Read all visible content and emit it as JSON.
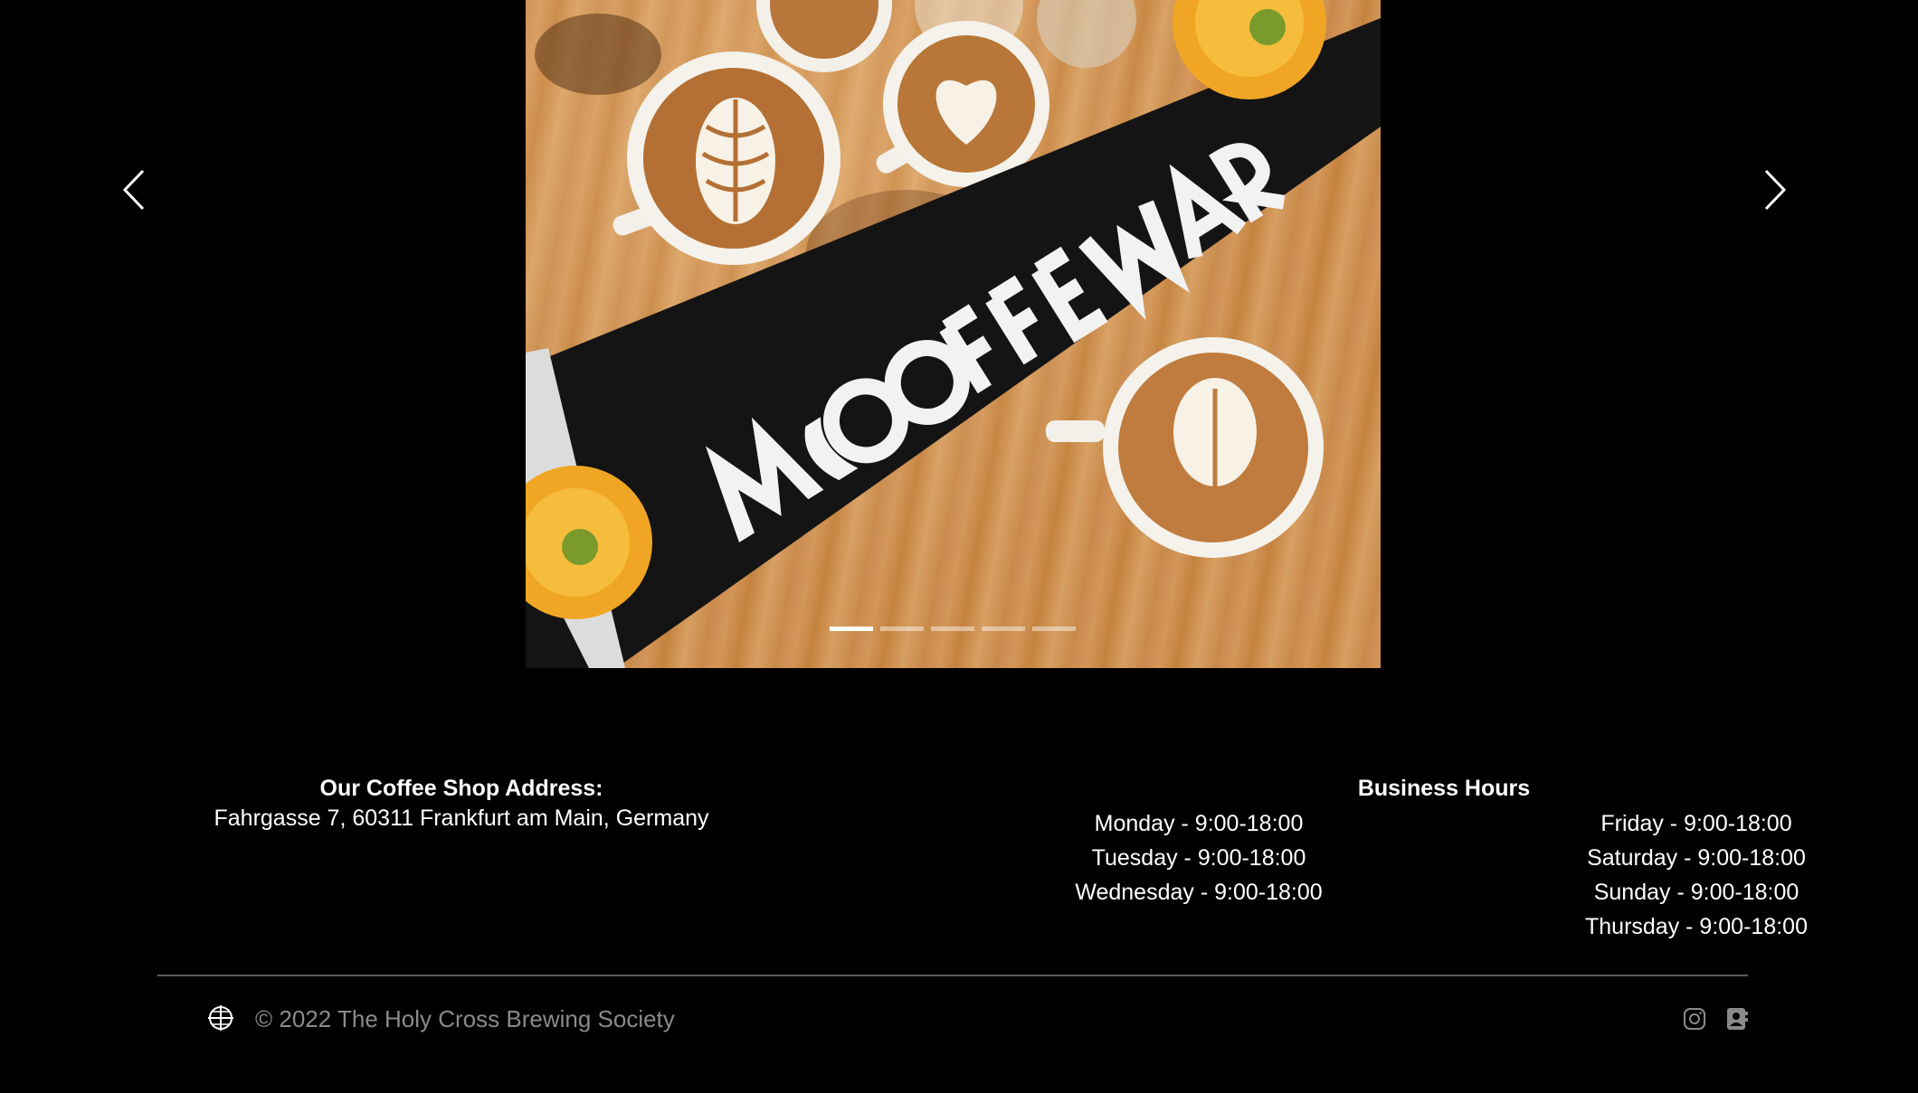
{
  "carousel": {
    "slide_image": "Latte art cups on wooden table with a black pennant reading Make Coffee Not War",
    "prev_icon": "chevron-left-icon",
    "next_icon": "chevron-right-icon",
    "slides_count": 5,
    "active_slide": 1
  },
  "address": {
    "label": "Our Coffee Shop Address:",
    "value": "Fahrgasse 7, 60311 Frankfurt am Main, Germany"
  },
  "hours": {
    "title": "Business Hours",
    "left": [
      "Monday - 9:00-18:00",
      "Tuesday - 9:00-18:00",
      "Wednesday - 9:00-18:00"
    ],
    "right": [
      "Friday - 9:00-18:00",
      "Saturday - 9:00-18:00",
      "Sunday - 9:00-18:00",
      "Thursday - 9:00-18:00"
    ]
  },
  "footer": {
    "logo_icon": "brand-logo-icon",
    "copyright": "© 2022 The Holy Cross Brewing Society",
    "social": [
      "instagram-icon",
      "contact-icon"
    ]
  },
  "colors": {
    "background": "#000000",
    "text": "#ffffff",
    "muted": "#8a8a8a",
    "divider": "#5a5a5a"
  }
}
